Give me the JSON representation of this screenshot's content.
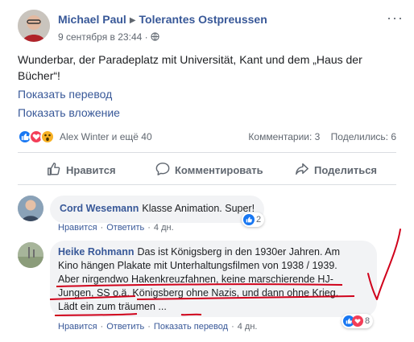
{
  "post": {
    "author": "Michael Paul",
    "group": "Tolerantes Ostpreussen",
    "date": "9 сентября в 23:44",
    "more": "···",
    "text": "Wunderbar, der Paradeplatz mit Universität, Kant und dem „Haus der Bücher“!",
    "translate_link": "Показать перевод",
    "attachment_link": "Показать вложение",
    "reactions_names": "Alex Winter и ещё 40",
    "comments_count": "Комментарии: 3",
    "shares_count": "Поделились: 6"
  },
  "actions": {
    "like": "Нравится",
    "comment": "Комментировать",
    "share": "Поделиться"
  },
  "comments": [
    {
      "name": "Cord Wesemann",
      "text": "Klasse Animation. Super!",
      "like": "Нравится",
      "reply": "Ответить",
      "time": "4 дн.",
      "reactions_count": "2"
    },
    {
      "name": "Heike Rohmann",
      "text_line1": "Das ist Königsberg in den 1930er Jahren. Am",
      "text_line2": "Kino hängen Plakate mit Unterhaltungsfilmen von 1938 / 1939.",
      "text_line3": "Aber nirgendwo Hakenkreuzfahnen, keine marschierende HJ-",
      "text_line4": "Jungen, SS o.ä. Königsberg ohne Nazis, und dann ohne Krieg.",
      "text_line5": "Lädt ein zum träumen ...",
      "like": "Нравится",
      "reply": "Ответить",
      "translate": "Показать перевод",
      "time": "4 дн.",
      "reactions_count": "8"
    }
  ],
  "colors": {
    "link": "#385898",
    "like": "#1877f2",
    "love": "#f33e58",
    "annotation": "#d0021b"
  }
}
